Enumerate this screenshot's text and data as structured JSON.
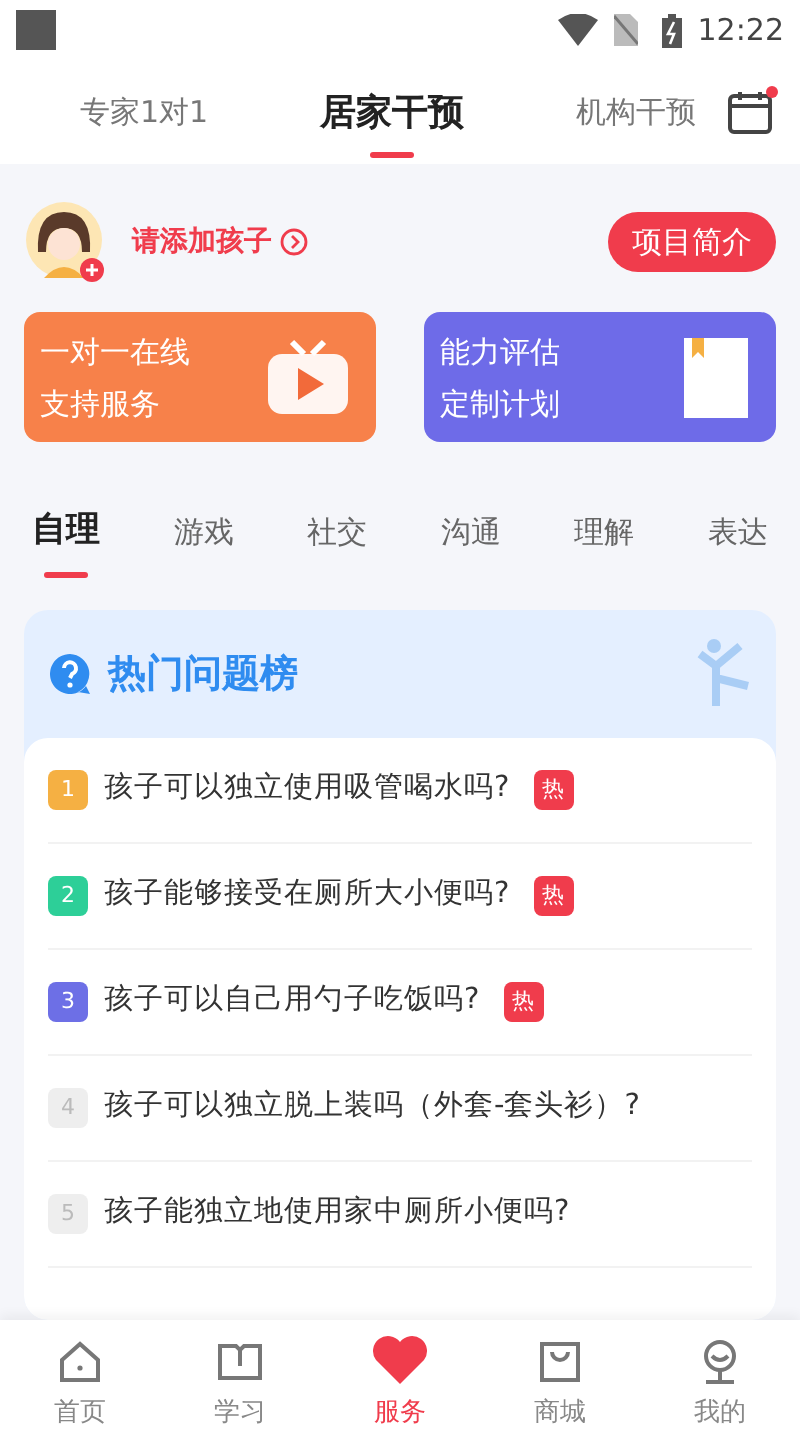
{
  "status_bar": {
    "time": "12:22"
  },
  "top_tabs": [
    {
      "label": "专家1对1",
      "selected": false
    },
    {
      "label": "居家干预",
      "selected": true
    },
    {
      "label": "机构干预",
      "selected": false
    }
  ],
  "calendar": {
    "has_notification": true
  },
  "child": {
    "prompt": "请添加孩子",
    "intro_button": "项目简介"
  },
  "promo_cards": [
    {
      "kind": "video",
      "lines": [
        "一对一在线",
        "支持服务"
      ]
    },
    {
      "kind": "document",
      "lines": [
        "能力评估",
        "定制计划"
      ]
    }
  ],
  "categories": [
    {
      "label": "自理",
      "selected": true
    },
    {
      "label": "游戏",
      "selected": false
    },
    {
      "label": "社交",
      "selected": false
    },
    {
      "label": "沟通",
      "selected": false
    },
    {
      "label": "理解",
      "selected": false
    },
    {
      "label": "表达",
      "selected": false
    }
  ],
  "hot_list": {
    "title": "热门问题榜",
    "items": [
      {
        "rank": "1",
        "color": "#f5b043",
        "text": "孩子可以独立使用吸管喝水吗?",
        "tag": "热"
      },
      {
        "rank": "2",
        "color": "#2dcf98",
        "text": "孩子能够接受在厕所大小便吗?",
        "tag": "热"
      },
      {
        "rank": "3",
        "color": "#6d6fe6",
        "text": "孩子可以自己用勺子吃饭吗?",
        "tag": "热"
      },
      {
        "rank": "4",
        "color": "#eeeeee",
        "text": "孩子可以独立脱上装吗（外套-套头衫）?"
      },
      {
        "rank": "5",
        "color": "#eeeeee",
        "text": "孩子能独立地使用家中厕所小便吗?"
      }
    ]
  },
  "bottom_nav": [
    {
      "kind": "home",
      "label": "首页",
      "selected": false
    },
    {
      "kind": "book",
      "label": "学习",
      "selected": false
    },
    {
      "kind": "heart",
      "label": "服务",
      "selected": true
    },
    {
      "kind": "bag",
      "label": "商城",
      "selected": false
    },
    {
      "kind": "person",
      "label": "我的",
      "selected": false
    }
  ]
}
